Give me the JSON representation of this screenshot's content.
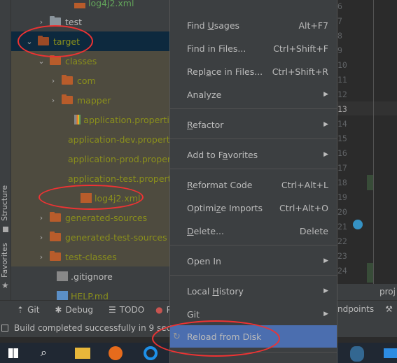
{
  "side_tabs": {
    "structure": "Structure",
    "favorites": "Favorites"
  },
  "tree": {
    "top_partial": "log4j2.xml",
    "items": [
      {
        "label": "test",
        "type": "folder-gray",
        "expanded": false
      },
      {
        "label": "target",
        "type": "folder",
        "expanded": true,
        "selected": true
      },
      {
        "label": "classes",
        "type": "folder",
        "expanded": true
      },
      {
        "label": "com",
        "type": "folder",
        "expanded": false
      },
      {
        "label": "mapper",
        "type": "folder",
        "expanded": false
      },
      {
        "label": "application.properties",
        "type": "properties"
      },
      {
        "label": "application-dev.properties",
        "type": "properties"
      },
      {
        "label": "application-prod.properties",
        "type": "properties"
      },
      {
        "label": "application-test.properties",
        "type": "properties"
      },
      {
        "label": "log4j2.xml",
        "type": "xml"
      },
      {
        "label": "generated-sources",
        "type": "folder",
        "expanded": false
      },
      {
        "label": "generated-test-sources",
        "type": "folder",
        "expanded": false
      },
      {
        "label": "test-classes",
        "type": "folder",
        "expanded": false
      },
      {
        "label": ".gitignore",
        "type": "ignore"
      },
      {
        "label": "HELP.md",
        "type": "md"
      }
    ]
  },
  "menu": {
    "find_usages": {
      "pre": "Find ",
      "u": "U",
      "post": "sages",
      "shortcut": "Alt+F7"
    },
    "find_in_files": {
      "label": "Find in Files...",
      "shortcut": "Ctrl+Shift+F"
    },
    "replace_in_files": {
      "pre": "Repl",
      "u": "a",
      "post": "ce in Files...",
      "shortcut": "Ctrl+Shift+R"
    },
    "analyze": {
      "label": "Analyze"
    },
    "refactor": {
      "pre": "",
      "u": "R",
      "post": "efactor"
    },
    "add_to_favorites": {
      "pre": "Add to F",
      "u": "a",
      "post": "vorites"
    },
    "reformat_code": {
      "pre": "",
      "u": "R",
      "post": "eformat Code",
      "shortcut": "Ctrl+Alt+L"
    },
    "optimize_imports": {
      "pre": "Optimi",
      "u": "z",
      "post": "e Imports",
      "shortcut": "Ctrl+Alt+O"
    },
    "delete": {
      "pre": "",
      "u": "D",
      "post": "elete...",
      "shortcut": "Delete"
    },
    "open_in": {
      "label": "Open In"
    },
    "local_history": {
      "pre": "Local ",
      "u": "H",
      "post": "istory"
    },
    "git": {
      "label": "Git"
    },
    "reload_from_disk": {
      "label": "Reload from Disk"
    }
  },
  "editor": {
    "line_numbers": [
      "6",
      "7",
      "8",
      "9",
      "10",
      "11",
      "12",
      "13",
      "14",
      "15",
      "16",
      "17",
      "18",
      "19",
      "20",
      "21",
      "22",
      "23",
      "24"
    ],
    "current_line": "13",
    "tab_partial": "proj"
  },
  "toolwindows": {
    "git": "Git",
    "debug": "Debug",
    "todo": "TODO",
    "problems_partial": "P",
    "endpoints_partial": "ndpoints"
  },
  "status": {
    "message": "Build completed successfully in 9 sec,"
  },
  "colors": {
    "highlight": "#4b6eaf",
    "annotation": "#e53935",
    "folder": "#b85c2b",
    "selected_row": "#0d293e",
    "excluded_bg": "#4e4b3f"
  }
}
